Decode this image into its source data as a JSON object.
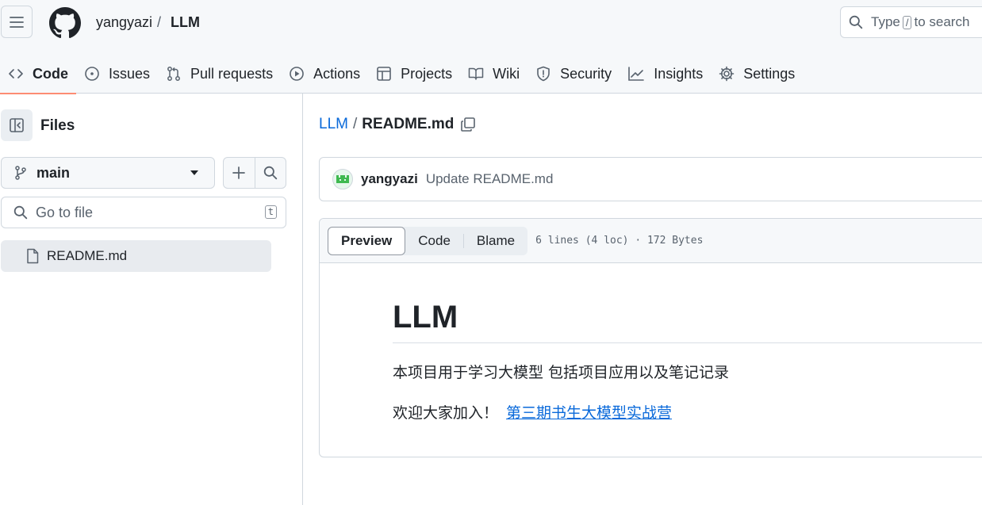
{
  "header": {
    "owner": "yangyazi",
    "separator": "/",
    "repo": "LLM",
    "search": {
      "prefix": "Type",
      "key": "/",
      "suffix": "to search"
    }
  },
  "nav": {
    "tabs": [
      {
        "label": "Code",
        "icon": "code-icon",
        "active": true
      },
      {
        "label": "Issues",
        "icon": "issue-opened-icon"
      },
      {
        "label": "Pull requests",
        "icon": "git-pull-request-icon"
      },
      {
        "label": "Actions",
        "icon": "play-icon"
      },
      {
        "label": "Projects",
        "icon": "table-icon"
      },
      {
        "label": "Wiki",
        "icon": "book-icon"
      },
      {
        "label": "Security",
        "icon": "shield-icon"
      },
      {
        "label": "Insights",
        "icon": "graph-icon"
      },
      {
        "label": "Settings",
        "icon": "gear-icon"
      }
    ]
  },
  "sidebar": {
    "title": "Files",
    "branch": "main",
    "goto_placeholder": "Go to file",
    "goto_shortcut": "t",
    "files": [
      {
        "name": "README.md",
        "icon": "file-icon"
      }
    ]
  },
  "breadcrumb": {
    "repo": "LLM",
    "separator": "/",
    "file": "README.md"
  },
  "commit": {
    "author": "yangyazi",
    "message": "Update README.md"
  },
  "file_view": {
    "modes": [
      "Preview",
      "Code",
      "Blame"
    ],
    "selected_mode": "Preview",
    "meta": "6 lines (4 loc) · 172 Bytes"
  },
  "readme": {
    "heading": "LLM",
    "line1": "本项目用于学习大模型 包括项目应用以及笔记记录",
    "line2_text": "欢迎大家加入！",
    "line2_link": "第三期书生大模型实战营"
  },
  "colors": {
    "accent_underline": "#fd8c73",
    "link": "#0969da",
    "border": "#d0d7de",
    "header_bg": "#f6f8fa"
  }
}
